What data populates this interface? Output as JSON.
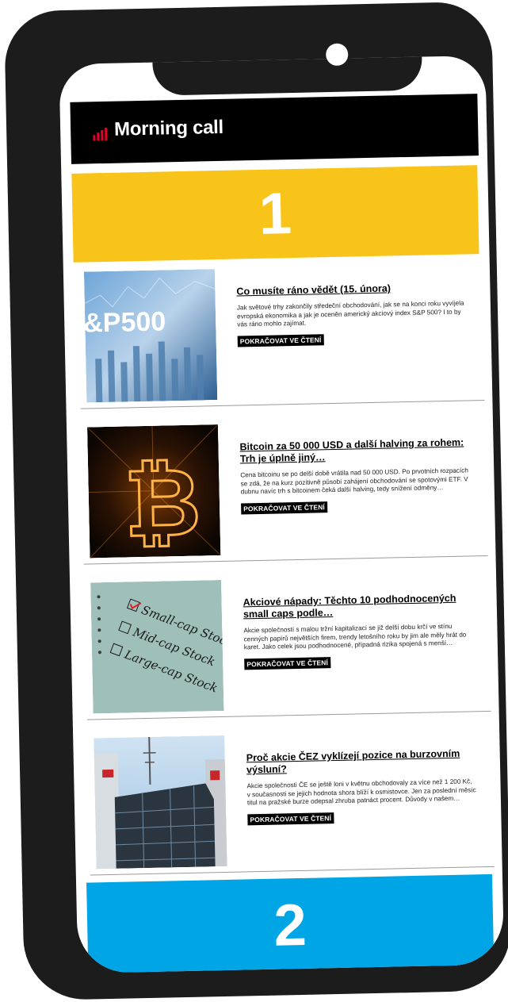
{
  "header": {
    "brand": "Morning call"
  },
  "sections": {
    "first_number": "1",
    "second_number": "2"
  },
  "articles": [
    {
      "title": "Co musíte ráno vědět (15. února)",
      "excerpt": "Jak světové trhy zakončily středeční obchodování, jak se na konci roku vyvíjela evropská ekonomika a jak je oceněn americký akciový index S&P 500? I to by vás ráno mohlo zajímat.",
      "cta": "POKRAČOVAT VE ČTENÍ",
      "image_text": "&P500"
    },
    {
      "title": "Bitcoin za 50 000 USD a další halving za rohem: Trh je úplně jiný…",
      "excerpt": "Cena bitcoinu se po delší době vrátila nad 50 000 USD. Po prvotních rozpacích se zdá, že na kurz pozitivně působí zahájení obchodování se spotovými ETF. V dubnu navíc trh s bitcoinem čeká další halving, tedy snížení odměny…",
      "cta": "POKRAČOVAT VE ČTENÍ",
      "image_text": "₿"
    },
    {
      "title": "Akciové nápady: Těchto 10 podhodnocených small caps podle…",
      "excerpt": "Akcie společností s malou tržní kapitalizací se již delší dobu krčí ve stínu cenných papírů největších firem, trendy letošního roku by jim ale měly hrát do karet. Jako celek jsou podhodnocené, případná rizika spojená s menší…",
      "cta": "POKRAČOVAT VE ČTENÍ",
      "image_lines": [
        "Small-cap Stock",
        "Mid-cap Stock",
        "Large-cap Stock"
      ]
    },
    {
      "title": "Proč akcie ČEZ vyklízejí pozice na burzovním výsluní?",
      "excerpt": "Akcie společnosti ČE se ještě loni v květnu obchodovaly za více než 1 200 Kč, v současnosti se jejich hodnota shora blíží k osmistovce. Jen za poslední měsíc titul na pražské burze odepsal zhruba patnáct procent. Důvody v našem…",
      "cta": "POKRAČOVAT VE ČTENÍ"
    }
  ],
  "colors": {
    "yellow": "#f9c41a",
    "blue": "#00a5e6",
    "brand_bars": "#e4002b"
  }
}
